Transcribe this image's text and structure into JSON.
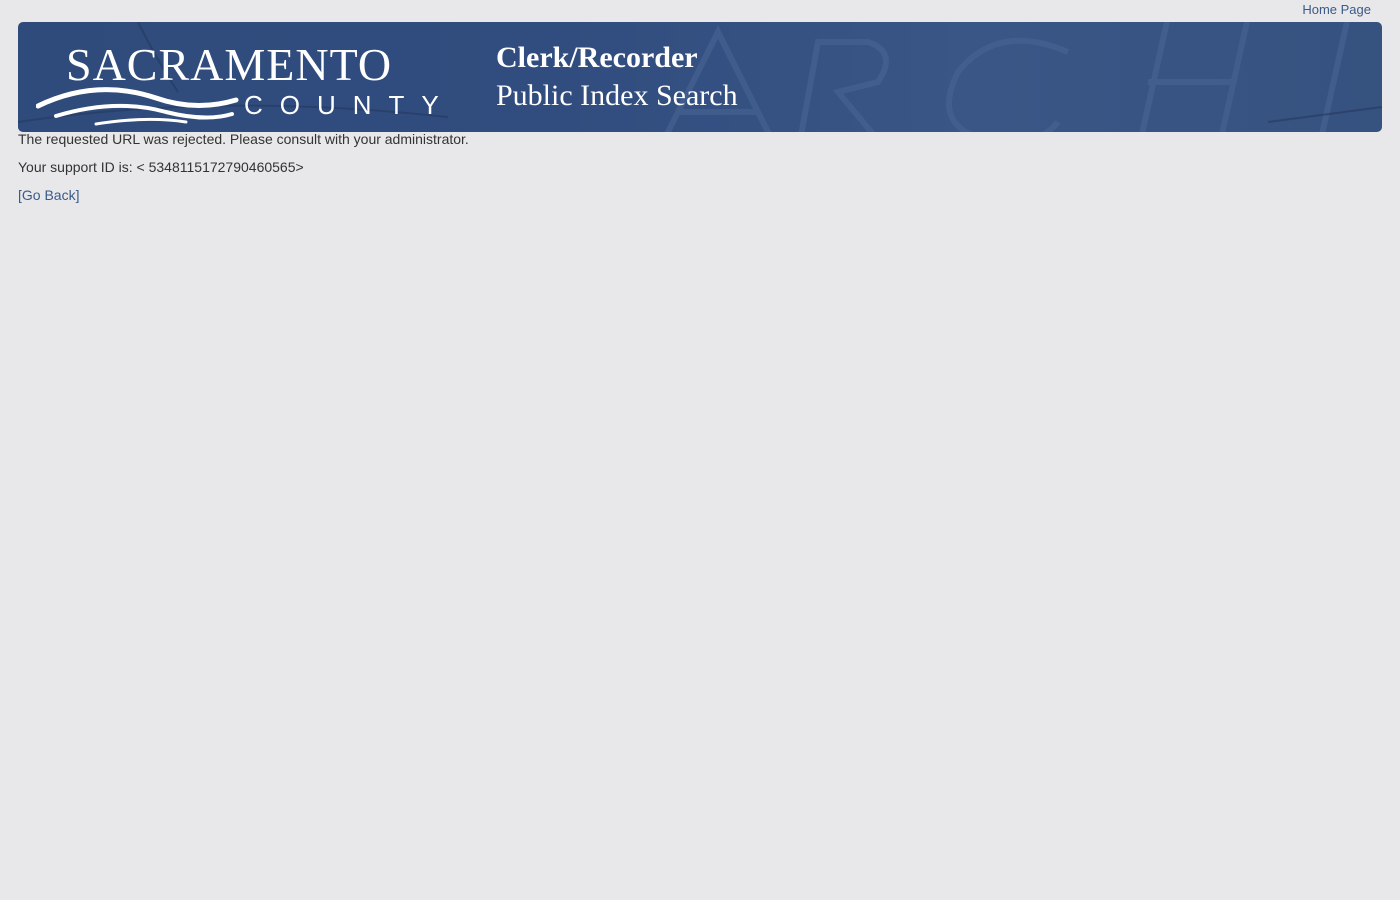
{
  "nav": {
    "home_label": "Home Page"
  },
  "banner": {
    "logo_top": "SACRAMENTO",
    "logo_bottom": "COUNTY",
    "title_line1": "Clerk/Recorder",
    "title_line2": "Public Index Search",
    "background_color": "#314d7f"
  },
  "message": {
    "rejected_text": "The requested URL was rejected. Please consult with your administrator.",
    "support_prefix": "Your support ID is: < 5348115172790460565>",
    "go_back_label": "[Go Back]"
  },
  "colors": {
    "link": "#3a5a8a",
    "page_bg": "#e8e8ea"
  }
}
